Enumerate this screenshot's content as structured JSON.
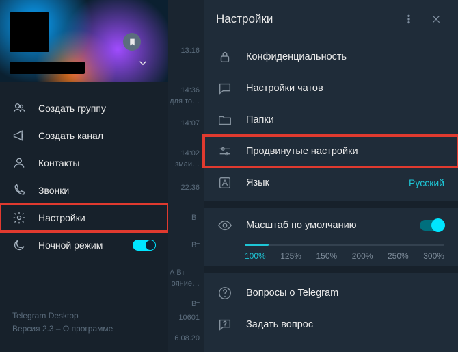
{
  "sidebar": {
    "menu": [
      {
        "label": "Создать группу"
      },
      {
        "label": "Создать канал"
      },
      {
        "label": "Контакты"
      },
      {
        "label": "Звонки"
      },
      {
        "label": "Настройки"
      },
      {
        "label": "Ночной режим"
      }
    ],
    "footer_app": "Telegram Desktop",
    "footer_version": "Версия 2.3 – О программе"
  },
  "chat_times": [
    "13:16",
    "14:36",
    "для то…",
    "14:07",
    "14:02",
    "змаи…",
    "22:36",
    "Вт",
    "Вт",
    "А   Вт",
    "ояние…",
    "Вт",
    "10601",
    "6.08.20"
  ],
  "settings": {
    "title": "Настройки",
    "items": [
      {
        "label": "Конфиденциальность"
      },
      {
        "label": "Настройки чатов"
      },
      {
        "label": "Папки"
      },
      {
        "label": "Продвинутые настройки"
      },
      {
        "label": "Язык",
        "value": "Русский"
      }
    ],
    "scale": {
      "label": "Масштаб по умолчанию",
      "options": [
        "100%",
        "125%",
        "150%",
        "200%",
        "250%",
        "300%"
      ],
      "active_index": 0
    },
    "faq": [
      {
        "label": "Вопросы о Telegram"
      },
      {
        "label": "Задать вопрос"
      }
    ]
  }
}
